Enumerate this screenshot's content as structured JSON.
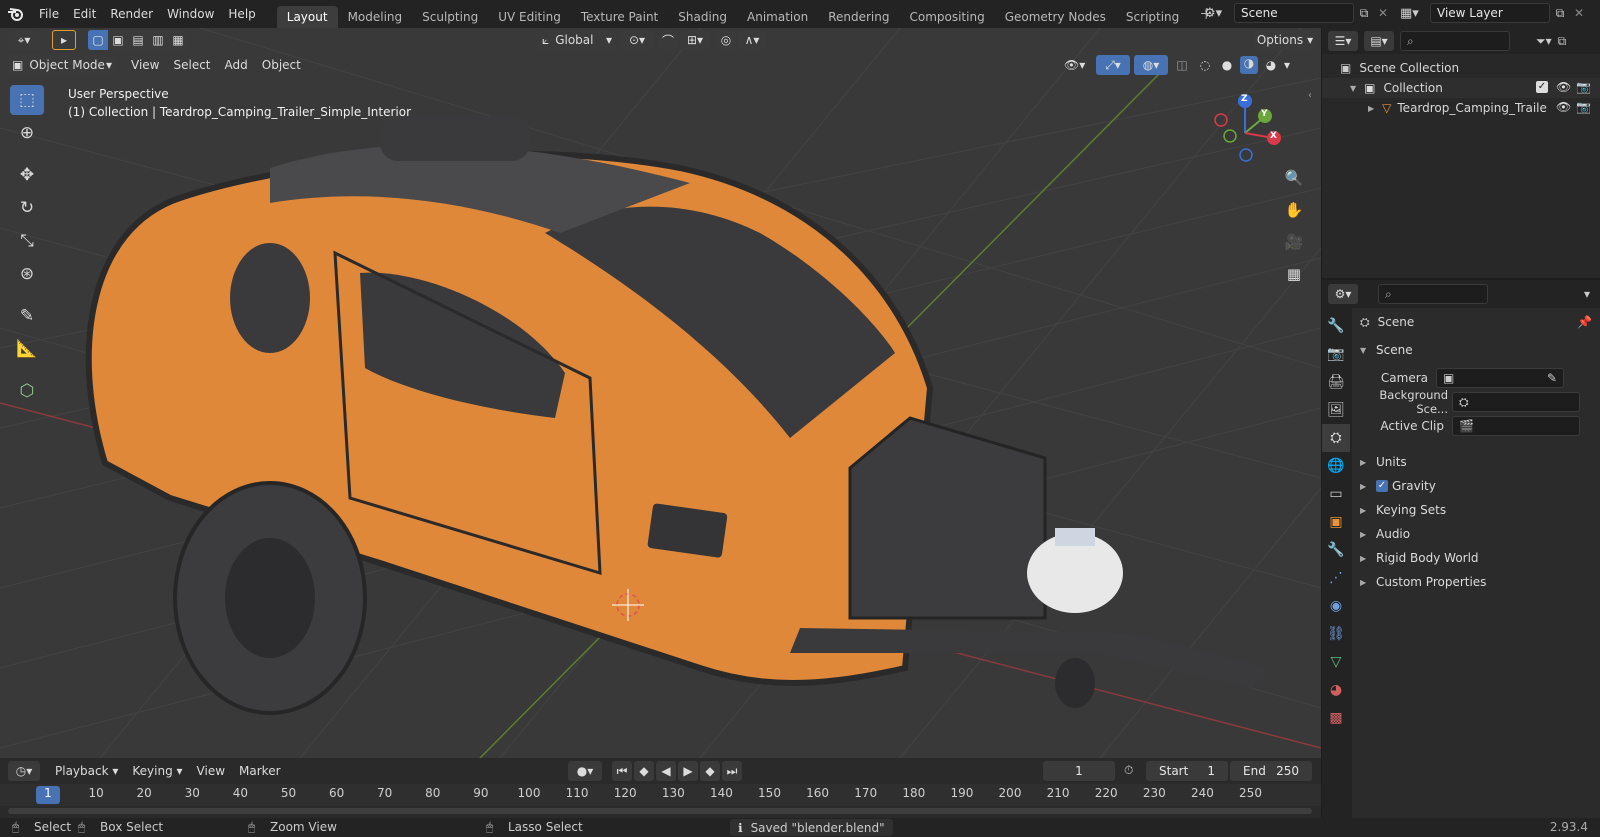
{
  "menubar": {
    "items": [
      "File",
      "Edit",
      "Render",
      "Window",
      "Help"
    ],
    "workspaces": [
      "Layout",
      "Modeling",
      "Sculpting",
      "UV Editing",
      "Texture Paint",
      "Shading",
      "Animation",
      "Rendering",
      "Compositing",
      "Geometry Nodes",
      "Scripting"
    ],
    "active_workspace": "Layout",
    "scene": "Scene",
    "view_layer": "View Layer"
  },
  "viewport": {
    "mode": "Object Mode",
    "menus": [
      "View",
      "Select",
      "Add",
      "Object"
    ],
    "orientation": "Global",
    "options_label": "Options",
    "overlay_title": "User Perspective",
    "overlay_subtitle": "(1) Collection | Teardrop_Camping_Trailer_Simple_Interior",
    "gizmo_axes": {
      "z": "Z",
      "y": "Y",
      "x": "X"
    },
    "accent": "#4772b3"
  },
  "outliner": {
    "root": "Scene Collection",
    "collection": "Collection",
    "object": "Teardrop_Camping_Traile"
  },
  "properties": {
    "breadcrumb": "Scene",
    "section": "Scene",
    "fields": [
      {
        "label": "Camera",
        "value": ""
      },
      {
        "label": "Background Sce...",
        "value": ""
      },
      {
        "label": "Active Clip",
        "value": ""
      }
    ],
    "panels": [
      "Units",
      "Gravity",
      "Keying Sets",
      "Audio",
      "Rigid Body World",
      "Custom Properties"
    ],
    "gravity_checked": true
  },
  "timeline": {
    "menus": [
      "Playback",
      "Keying",
      "View",
      "Marker"
    ],
    "current_frame": "1",
    "start_label": "Start",
    "start_value": "1",
    "end_label": "End",
    "end_value": "250",
    "ticks": [
      "1",
      "10",
      "20",
      "30",
      "40",
      "50",
      "60",
      "70",
      "80",
      "90",
      "100",
      "110",
      "120",
      "130",
      "140",
      "150",
      "160",
      "170",
      "180",
      "190",
      "200",
      "210",
      "220",
      "230",
      "240",
      "250"
    ]
  },
  "statusbar": {
    "select": "Select",
    "box_select": "Box Select",
    "zoom_view": "Zoom View",
    "lasso_select": "Lasso Select",
    "message": "Saved \"blender.blend\"",
    "version": "2.93.4"
  }
}
